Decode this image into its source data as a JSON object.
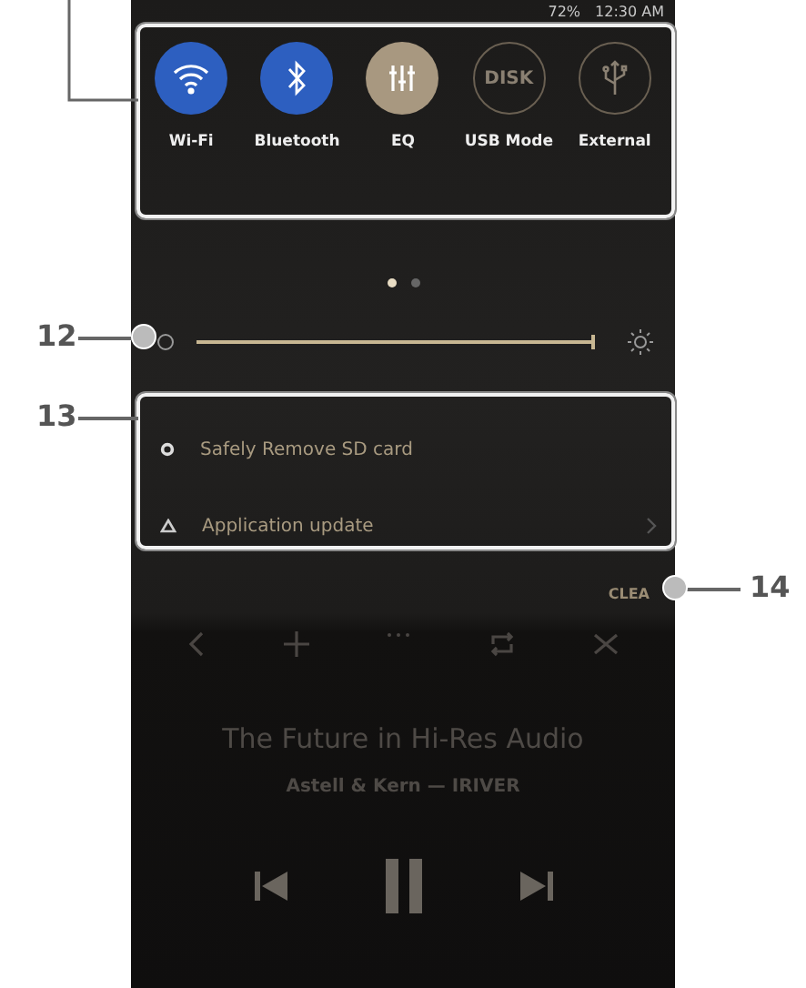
{
  "status_bar": {
    "battery": "72%",
    "time": "12:30 AM"
  },
  "quick_settings": [
    {
      "kind": "wifi",
      "label": "Wi-Fi",
      "on": true,
      "color": "#2d5fc0"
    },
    {
      "kind": "bluetooth",
      "label": "Bluetooth",
      "on": true,
      "color": "#2d5fc0"
    },
    {
      "kind": "eq",
      "label": "EQ",
      "on": true,
      "color": "#a89880"
    },
    {
      "kind": "disk",
      "label": "USB Mode",
      "icon_text": "DISK",
      "on": false,
      "color": "#6a6052"
    },
    {
      "kind": "usb",
      "label": "External",
      "on": false,
      "color": "#6a6052"
    }
  ],
  "page_indicator": [
    {
      "selected": true
    },
    {
      "selected": false
    }
  ],
  "brightness": {
    "level": 0.97
  },
  "notifications": [
    {
      "kind": "sd",
      "text": "Safely Remove SD card",
      "chevron": false
    },
    {
      "kind": "update",
      "text": "Application update",
      "chevron": true
    }
  ],
  "clear_button": "CLEA",
  "player": {
    "title": "The Future in Hi-Res Audio",
    "artist": "Astell & Kern — IRIVER"
  },
  "callouts": [
    {
      "number": "12"
    },
    {
      "number": "13"
    },
    {
      "number": "14"
    }
  ]
}
